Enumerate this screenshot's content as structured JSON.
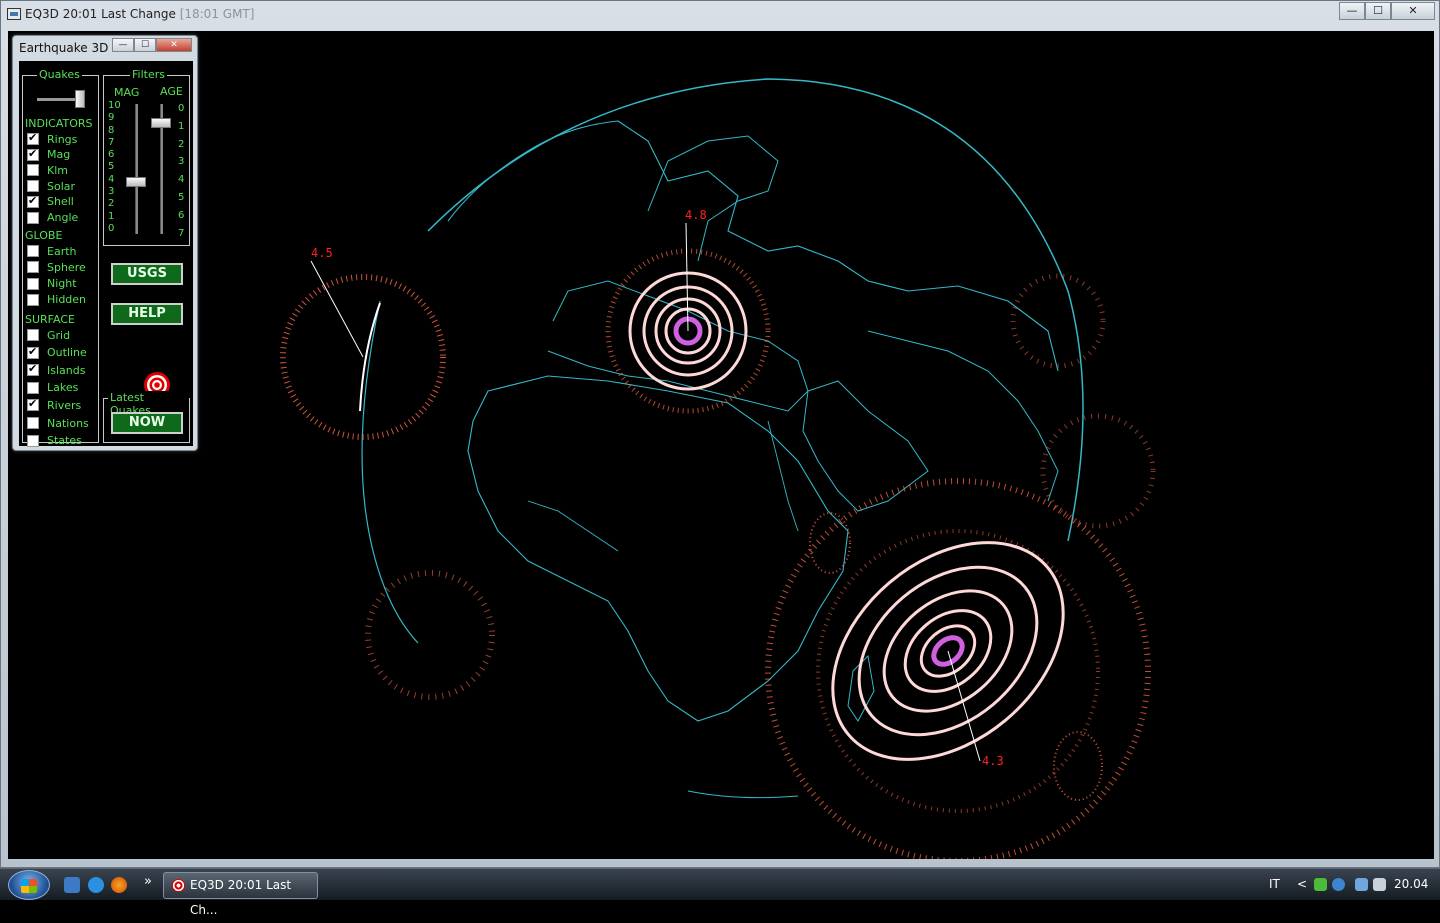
{
  "window": {
    "title": "EQ3D  20:01 Last Change",
    "title_ghost": " [18:01 GMT]",
    "minimize": "—",
    "maximize": "☐",
    "close": "✕"
  },
  "panel": {
    "title": "Earthquake 3D",
    "quakes_group": "Quakes",
    "filters_group": "Filters",
    "mag_label": "MAG",
    "age_label": "AGE",
    "mag_scale": [
      "10",
      "9",
      "8",
      "7",
      "6",
      "5",
      "4",
      "3",
      "2",
      "1",
      "0"
    ],
    "age_scale": [
      "0",
      "1",
      "2",
      "3",
      "4",
      "5",
      "6",
      "7"
    ],
    "mag_value": 4,
    "age_value": 1,
    "quakes_slider_fraction": 0.9,
    "indicators_label": "INDICATORS",
    "indicators": [
      {
        "label": "Rings",
        "checked": true
      },
      {
        "label": "Mag",
        "checked": true
      },
      {
        "label": "Klm",
        "checked": false
      },
      {
        "label": "Solar",
        "checked": false
      },
      {
        "label": "Shell",
        "checked": true
      },
      {
        "label": "Angle",
        "checked": false
      }
    ],
    "globe_label": "GLOBE",
    "globe": [
      {
        "label": "Earth",
        "checked": false
      },
      {
        "label": "Sphere",
        "checked": false
      },
      {
        "label": "Night",
        "checked": false
      },
      {
        "label": "Hidden",
        "checked": false
      }
    ],
    "surface_label": "SURFACE",
    "surface": [
      {
        "label": "Grid",
        "checked": false
      },
      {
        "label": "Outline",
        "checked": true
      },
      {
        "label": "Islands",
        "checked": true
      },
      {
        "label": "Lakes",
        "checked": false
      },
      {
        "label": "Rivers",
        "checked": true
      },
      {
        "label": "Nations",
        "checked": false
      },
      {
        "label": "States",
        "checked": false
      }
    ],
    "usgs_button": "USGS",
    "help_button": "HELP",
    "latest_group": "Latest Quakes",
    "now_button": "NOW"
  },
  "quakes": [
    {
      "name": "europe",
      "mag_label": "4.8"
    },
    {
      "name": "atlantic",
      "mag_label": "4.5"
    },
    {
      "name": "indian-ocean",
      "mag_label": "4.3"
    }
  ],
  "colors": {
    "coast": "#34b8c8",
    "ring": "#ffd2d2",
    "shell_dots": "#ff6a4a",
    "mag_text": "#ff2020",
    "panel_text": "#58e058",
    "button_green": "#0e6a1a"
  },
  "taskbar": {
    "task_label": "EQ3D  20:01 Last Ch...",
    "more": "»",
    "lang": "IT",
    "chevron": "<",
    "clock": "20.04"
  }
}
